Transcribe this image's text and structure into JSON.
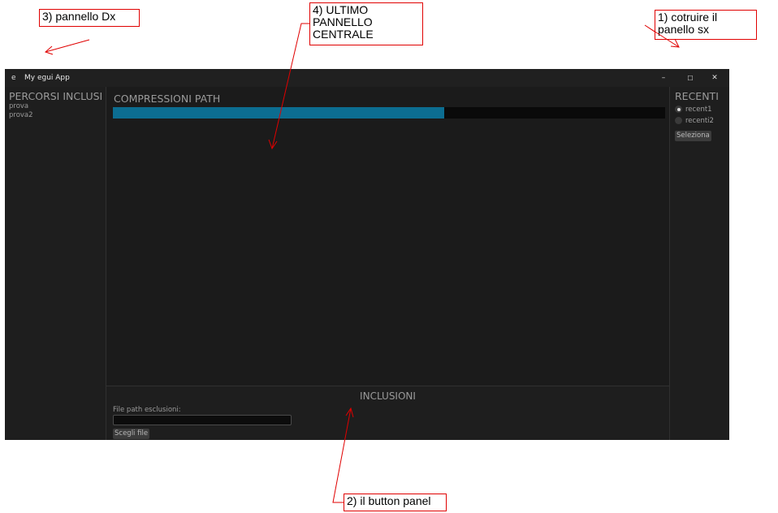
{
  "annotations": {
    "right_panel": "3) pannello Dx",
    "central_panel": "4) ULTIMO\nPANNELLO\nCENTRALE",
    "left_panel": "1) cotruire il\npanello sx",
    "bottom_panel": "2) il button panel",
    "color": "#e00000"
  },
  "window": {
    "icon_glyph": "e",
    "title": "My egui App",
    "minimize_glyph": "–",
    "maximize_glyph": "☐",
    "close_glyph": "✕"
  },
  "left_panel": {
    "heading": "PERCORSI INCLUSI",
    "items": [
      "prova",
      "prova2"
    ]
  },
  "central_panel": {
    "heading": "COMPRESSIONI PATH",
    "progress": 0.6,
    "progress_color": "#0c6d91"
  },
  "right_panel": {
    "heading": "RECENTI",
    "options": [
      {
        "label": "recent1",
        "selected": true
      },
      {
        "label": "recenti2",
        "selected": false
      }
    ],
    "select_button": "Seleziona"
  },
  "bottom_panel": {
    "heading": "INCLUSIONI",
    "field_label": "File path esclusioni:",
    "field_value": "",
    "choose_button": "Scegli file"
  }
}
